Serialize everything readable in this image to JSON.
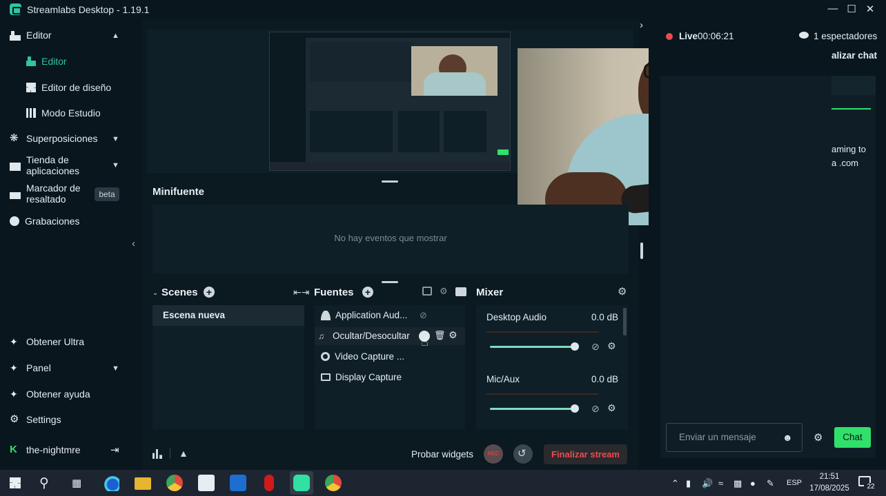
{
  "window": {
    "title": "Streamlabs Desktop - 1.19.1"
  },
  "sidebar": {
    "items": [
      {
        "label": "Editor"
      },
      {
        "label": "Editor"
      },
      {
        "label": "Editor de diseño"
      },
      {
        "label": "Modo Estudio"
      },
      {
        "label": "Superposiciones"
      },
      {
        "label": "Tienda de aplicaciones"
      },
      {
        "label": "Marcador de resaltado",
        "badge": "beta"
      },
      {
        "label": "Grabaciones"
      },
      {
        "label": "Obtener Ultra"
      },
      {
        "label": "Panel"
      },
      {
        "label": "Obtener ayuda"
      },
      {
        "label": "Settings"
      },
      {
        "label": "the-nightmre"
      }
    ],
    "tienda_line1": "Tienda de",
    "tienda_line2": "aplicaciones",
    "marcador_line1": "Marcador de",
    "marcador_line2": "resaltado"
  },
  "minifuente": {
    "title": "Minifuente",
    "empty_text": "No hay eventos que mostrar"
  },
  "scenes": {
    "title": "Scenes",
    "items": [
      "Escena nueva"
    ]
  },
  "sources": {
    "title": "Fuentes",
    "items": [
      "Application Aud...",
      "Ocultar/Desocultar",
      "Video Capture ...",
      "Display Capture"
    ]
  },
  "mixer": {
    "title": "Mixer",
    "channels": [
      {
        "name": "Desktop Audio",
        "level": "0.0 dB"
      },
      {
        "name": "Mic/Aux",
        "level": "0.0 dB"
      }
    ]
  },
  "bottom_bar": {
    "test_widgets": "Probar widgets",
    "rec_label": "REC",
    "end_stream": "Finalizar stream"
  },
  "live": {
    "label": "Live",
    "time": "00:06:21",
    "viewers": "1 espectadores"
  },
  "chat": {
    "header_partial": "alizar chat",
    "partial_1": "aming to",
    "partial_2": "a .com",
    "input_placeholder": "Enviar un mensaje",
    "send_label": "Chat"
  },
  "taskbar": {
    "lang": "ESP",
    "time": "21:51",
    "date": "17/08/2025",
    "notifications": "22"
  },
  "colors": {
    "accent": "#31c3a2",
    "live_red": "#ef4a4a",
    "chat_green": "#31e06b"
  }
}
